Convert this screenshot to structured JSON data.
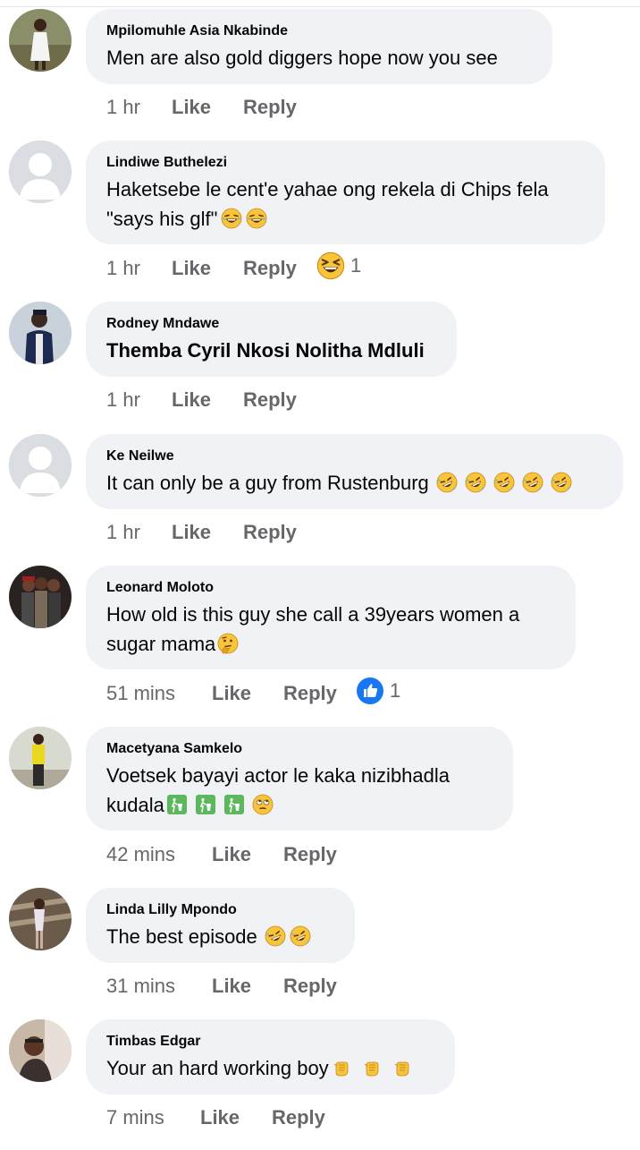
{
  "comments": [
    {
      "name": "Mpilomuhle Asia Nkabinde",
      "line1": "Men are also gold diggers hope now you see",
      "line2": "",
      "time": "1 hr",
      "like": "Like",
      "reply": "Reply",
      "reaction_count": ""
    },
    {
      "name": "Lindiwe Buthelezi",
      "line1": "Haketsebe le cent'e yahae ong rekela di Chips fela",
      "line2": "\"says his glf\"",
      "time": "1 hr",
      "like": "Like",
      "reply": "Reply",
      "reaction_count": "1",
      "reaction_icon": "laughing-squint-icon"
    },
    {
      "name": "Rodney Mndawe",
      "line1": "Themba Cyril Nkosi Nolitha Mdluli",
      "line2": "",
      "time": "1 hr",
      "like": "Like",
      "reply": "Reply",
      "reaction_count": ""
    },
    {
      "name": "Ke Neilwe",
      "line1": "It can only be a guy from Rustenburg",
      "line2": "",
      "time": "1 hr",
      "like": "Like",
      "reply": "Reply",
      "reaction_count": ""
    },
    {
      "name": "Leonard Moloto",
      "line1": "How old is this guy she call a 39years women a",
      "line2": "sugar mama",
      "time": "51 mins",
      "like": "Like",
      "reply": "Reply",
      "reaction_count": "1",
      "reaction_icon": "like-thumb-icon"
    },
    {
      "name": "Macetyana Samkelo",
      "line1": "Voetsek bayayi actor  le kaka  nizibhadla",
      "line2": "kudala",
      "time": "42 mins",
      "like": "Like",
      "reply": "Reply",
      "reaction_count": ""
    },
    {
      "name": "Linda Lilly Mpondo",
      "line1": "The best episode",
      "line2": "",
      "time": "31 mins",
      "like": "Like",
      "reply": "Reply",
      "reaction_count": ""
    },
    {
      "name": "Timbas Edgar",
      "line1": "Your an hard working boy",
      "line2": "",
      "time": "7 mins",
      "like": "Like",
      "reply": "Reply",
      "reaction_count": ""
    }
  ],
  "colors": {
    "bubble": "#f0f2f5",
    "meta": "#65676b",
    "like_blue": "#1877f2",
    "emoji_yellow": "#f7c43b"
  }
}
